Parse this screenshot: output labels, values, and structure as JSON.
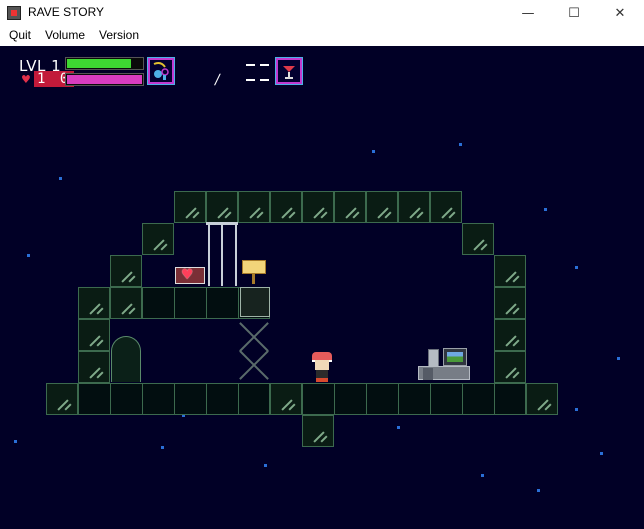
{
  "window": {
    "title": "RAVE STORY",
    "controls": {
      "minimize": "—",
      "maximize": "☐",
      "close": "✕"
    }
  },
  "menu": {
    "items": [
      "Quit",
      "Volume",
      "Version"
    ]
  },
  "hud": {
    "level_text": "LVL 1",
    "health_text": "1 0",
    "exp_fraction": 0.85,
    "health_fraction": 1.0,
    "exp_color": "#3ed832",
    "health_color": "#d83cc0",
    "ammo_text": "/",
    "weapon_icon": "bubbler-icon",
    "item_icon": "martini-glass-icon"
  }
}
